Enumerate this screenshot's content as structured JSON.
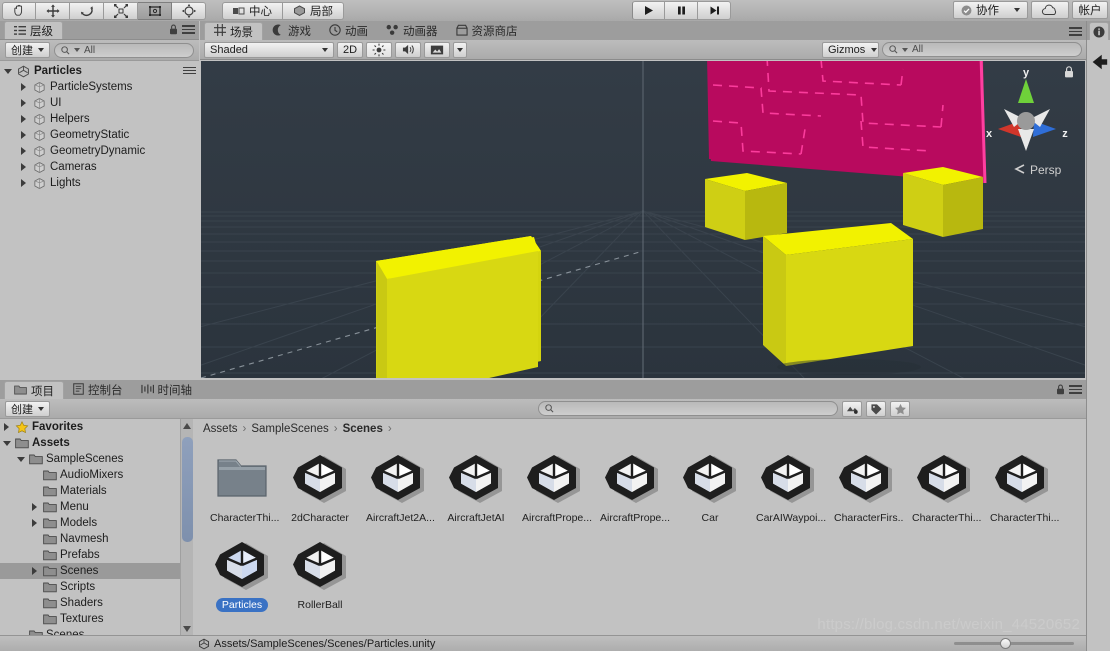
{
  "toolbar": {
    "transform_tools": [
      {
        "name": "hand-tool",
        "active": false
      },
      {
        "name": "move-tool",
        "active": false
      },
      {
        "name": "rotate-tool",
        "active": false
      },
      {
        "name": "scale-tool",
        "active": false
      },
      {
        "name": "rect-tool",
        "active": true
      },
      {
        "name": "transform-tool",
        "active": false
      }
    ],
    "pivot_mode": "中心",
    "pivot_rotation": "局部",
    "play": "▶",
    "pause": "❚❚",
    "step": "▶❚",
    "collab_label": "协作",
    "account_label": "帐户"
  },
  "hierarchy": {
    "tab_label": "层级",
    "create_label": "创建",
    "search_placeholder": "All",
    "root": "Particles",
    "items": [
      {
        "label": "ParticleSystems",
        "depth": 1
      },
      {
        "label": "UI",
        "depth": 1
      },
      {
        "label": "Helpers",
        "depth": 1
      },
      {
        "label": "GeometryStatic",
        "depth": 1
      },
      {
        "label": "GeometryDynamic",
        "depth": 1
      },
      {
        "label": "Cameras",
        "depth": 1
      },
      {
        "label": "Lights",
        "depth": 1
      }
    ]
  },
  "scene": {
    "tabs": [
      {
        "label": "场景",
        "active": true,
        "icon": "grid-icon"
      },
      {
        "label": "游戏",
        "active": false,
        "icon": "gamepad-icon"
      },
      {
        "label": "动画",
        "active": false,
        "icon": "clock-icon"
      },
      {
        "label": "动画器",
        "active": false,
        "icon": "animator-icon"
      },
      {
        "label": "资源商店",
        "active": false,
        "icon": "store-icon"
      }
    ],
    "shading_mode": "Shaded",
    "mode_2d": "2D",
    "gizmos_label": "Gizmos",
    "search_placeholder": "All",
    "axis_x": "x",
    "axis_y": "y",
    "axis_z": "z",
    "camera_mode": "Persp",
    "colors": {
      "background": "#2f3841",
      "cube_top": "#f2f200",
      "cube_front": "#cfcf14",
      "cube_side": "#b8b80f",
      "wall": "#b80a5e",
      "wall_lines": "#ff3fa0"
    }
  },
  "project": {
    "tabs": [
      {
        "label": "项目",
        "active": true,
        "icon": "folder-icon"
      },
      {
        "label": "控制台",
        "active": false,
        "icon": "console-icon"
      },
      {
        "label": "时间轴",
        "active": false,
        "icon": "timeline-icon"
      }
    ],
    "create_label": "创建",
    "search_placeholder": "",
    "breadcrumb": [
      "Assets",
      "SampleScenes",
      "Scenes"
    ],
    "tree": [
      {
        "label": "Favorites",
        "depth": 0,
        "icon": "star-icon",
        "arrow": "closed",
        "bold": true
      },
      {
        "label": "Assets",
        "depth": 0,
        "icon": "folder-icon",
        "arrow": "open",
        "bold": true
      },
      {
        "label": "SampleScenes",
        "depth": 1,
        "icon": "folder-icon",
        "arrow": "open",
        "bold": false
      },
      {
        "label": "AudioMixers",
        "depth": 2,
        "icon": "folder-icon",
        "arrow": "none",
        "bold": false
      },
      {
        "label": "Materials",
        "depth": 2,
        "icon": "folder-icon",
        "arrow": "none",
        "bold": false
      },
      {
        "label": "Menu",
        "depth": 2,
        "icon": "folder-icon",
        "arrow": "closed",
        "bold": false
      },
      {
        "label": "Models",
        "depth": 2,
        "icon": "folder-icon",
        "arrow": "closed",
        "bold": false
      },
      {
        "label": "Navmesh",
        "depth": 2,
        "icon": "folder-icon",
        "arrow": "none",
        "bold": false
      },
      {
        "label": "Prefabs",
        "depth": 2,
        "icon": "folder-icon",
        "arrow": "none",
        "bold": false
      },
      {
        "label": "Scenes",
        "depth": 2,
        "icon": "folder-icon",
        "arrow": "closed",
        "bold": false,
        "selected": true
      },
      {
        "label": "Scripts",
        "depth": 2,
        "icon": "folder-icon",
        "arrow": "none",
        "bold": false
      },
      {
        "label": "Shaders",
        "depth": 2,
        "icon": "folder-icon",
        "arrow": "none",
        "bold": false
      },
      {
        "label": "Textures",
        "depth": 2,
        "icon": "folder-icon",
        "arrow": "none",
        "bold": false
      },
      {
        "label": "Scenes",
        "depth": 1,
        "icon": "folder-icon",
        "arrow": "none",
        "bold": false
      }
    ],
    "assets": [
      {
        "label": "CharacterThi...",
        "type": "folder",
        "selected": false
      },
      {
        "label": "2dCharacter",
        "type": "scene",
        "selected": false
      },
      {
        "label": "AircraftJet2A...",
        "type": "scene",
        "selected": false
      },
      {
        "label": "AircraftJetAI",
        "type": "scene",
        "selected": false
      },
      {
        "label": "AircraftPrope...",
        "type": "scene",
        "selected": false
      },
      {
        "label": "AircraftPrope...",
        "type": "scene",
        "selected": false
      },
      {
        "label": "Car",
        "type": "scene",
        "selected": false
      },
      {
        "label": "CarAIWaypoi...",
        "type": "scene",
        "selected": false
      },
      {
        "label": "CharacterFirs...",
        "type": "scene",
        "selected": false
      },
      {
        "label": "CharacterThi...",
        "type": "scene",
        "selected": false
      },
      {
        "label": "CharacterThi...",
        "type": "scene",
        "selected": false
      },
      {
        "label": "Particles",
        "type": "scene",
        "selected": true
      },
      {
        "label": "RollerBall",
        "type": "scene",
        "selected": false
      }
    ],
    "status_path": "Assets/SampleScenes/Scenes/Particles.unity"
  },
  "watermark": "https://blog.csdn.net/weixin_44520652"
}
